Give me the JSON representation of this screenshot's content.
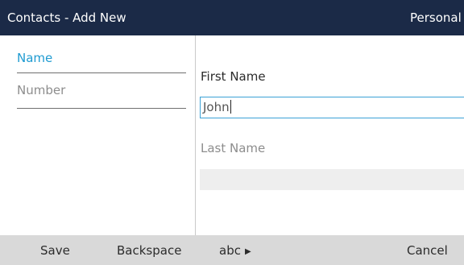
{
  "header": {
    "title": "Contacts - Add New",
    "account": "Personal"
  },
  "sidebar": {
    "items": [
      {
        "label": "Name",
        "state": "active"
      },
      {
        "label": "Number",
        "state": "inactive"
      }
    ]
  },
  "form": {
    "first_name": {
      "label": "First Name",
      "value": "John"
    },
    "last_name": {
      "label": "Last Name",
      "value": ""
    }
  },
  "softkeys": {
    "save": "Save",
    "backspace": "Backspace",
    "input_mode": "abc",
    "input_mode_icon": "triangle-right-icon",
    "cancel": "Cancel"
  },
  "colors": {
    "titlebar_bg": "#1b2a47",
    "active_accent": "#1f9bd1",
    "focus_border": "#3ba2d6",
    "softkey_bar_bg": "#d9d9d9",
    "inactive_field_bg": "#eeeeee"
  }
}
